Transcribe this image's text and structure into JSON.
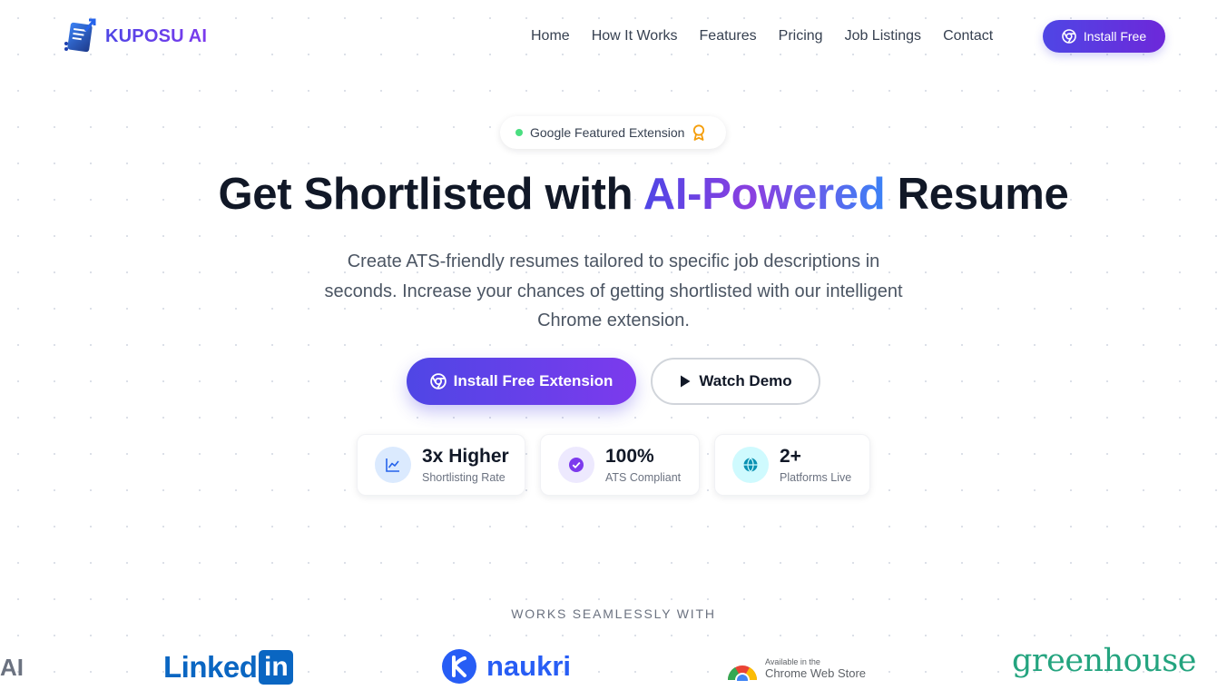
{
  "brand": {
    "name": "KUPOSU AI",
    "logo_icon": "document-arrow-logo"
  },
  "nav": {
    "items": [
      "Home",
      "How It Works",
      "Features",
      "Pricing",
      "Job Listings",
      "Contact"
    ],
    "cta_label": "Install Free",
    "cta_icon": "chrome-icon"
  },
  "badge": {
    "label": "Google Featured Extension",
    "icon": "award-medal-icon",
    "dot_color": "#4ade80"
  },
  "hero": {
    "title_before": "Get Shortlisted with ",
    "title_highlight": "AI-Powered",
    "title_after": " Resume",
    "subtitle": "Create ATS-friendly resumes tailored to specific job descriptions in seconds. Increase your chances of getting shortlisted with our intelligent Chrome extension."
  },
  "buttons": {
    "primary_label": "Install Free Extension",
    "primary_icon": "chrome-icon",
    "secondary_label": "Watch Demo",
    "secondary_icon": "play-icon"
  },
  "stats": [
    {
      "value": "3x Higher",
      "label": "Shortlisting Rate",
      "icon": "trend-chart-icon",
      "color": "#3b82f6"
    },
    {
      "value": "100%",
      "label": "ATS Compliant",
      "icon": "check-circle-icon",
      "color": "#7c3aed"
    },
    {
      "value": "2+",
      "label": "Platforms Live",
      "icon": "globe-icon",
      "color": "#06b6d4"
    }
  ],
  "works_with": {
    "title": "WORKS SEAMLESSLY WITH",
    "cut_logo": "AI",
    "linkedin_text": "Linked",
    "linkedin_box": "in",
    "naukri_text": "naukri",
    "cws_small": "Available in the",
    "cws_big": "Chrome Web Store",
    "greenhouse_text": "greenhouse"
  },
  "colors": {
    "primary": "#4f46e5",
    "accent": "#7c3aed",
    "text": "#111827"
  }
}
